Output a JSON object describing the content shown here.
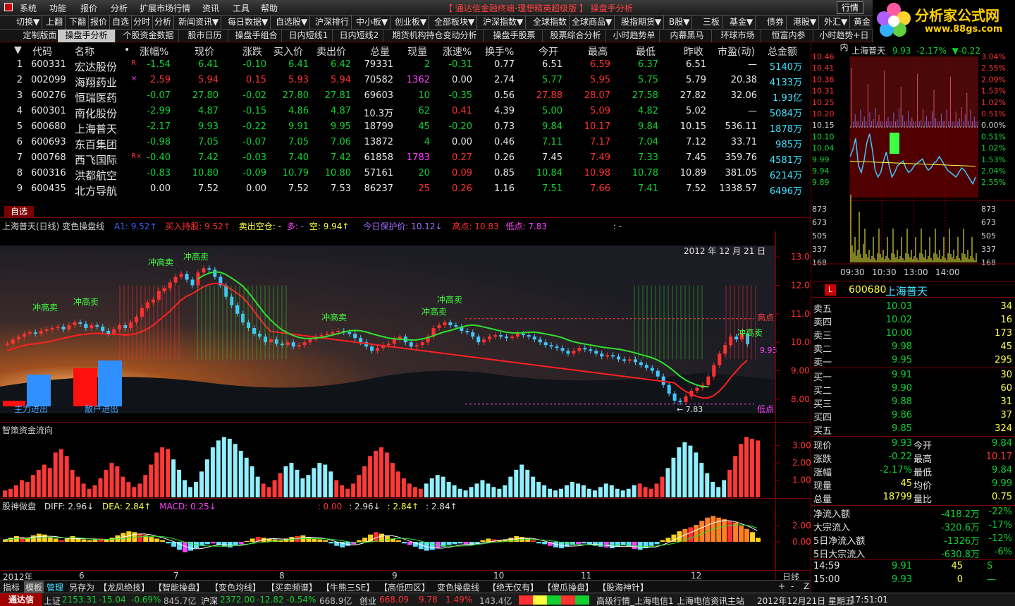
{
  "menu": [
    "系统",
    "功能",
    "报价",
    "分析",
    "扩展市场行情",
    "资讯",
    "工具",
    "帮助"
  ],
  "window_title": "【 通达信金融终端-理想精英超级版 】    操盘手分析",
  "menu_right_button": "行情",
  "logo": {
    "name": "分析家公式网",
    "url": "www.88gs.com"
  },
  "toolbar": [
    "切换▼",
    "上翻",
    "下翻",
    "报价",
    "自选",
    "分时",
    "分析",
    "新闻资讯▼",
    "每日数据▼",
    "自选股▼",
    "沪深排行",
    "中小板▼",
    "创业板▼",
    "全部板块▼",
    "沪深指数▼",
    "全球指数",
    "全球商品▼",
    "股指期货▼",
    "B股▼",
    "三板",
    "基金▼",
    "债券",
    "港股▼",
    "外汇▼",
    "黄金"
  ],
  "tabs": [
    "定制版面",
    "操盘手分析",
    "个股资金数据",
    "股市日历",
    "操盘手组合",
    "日内短线1",
    "日内短线2",
    "期货机构持仓变动分析",
    "操盘手股票",
    "股票综合分析",
    "小时趋势单",
    "内幕黑马",
    "环球市场",
    "恒富内参",
    "小时趋势+日内"
  ],
  "active_tab": 1,
  "table": {
    "headers": [
      "▼",
      "代码",
      "名称",
      "•",
      "涨幅%",
      "现价",
      "涨跌",
      "买入价",
      "卖出价",
      "总量",
      "现量",
      "涨速%",
      "换手%",
      "今开",
      "最高",
      "最低",
      "昨收",
      "市盈(动)",
      "总金额"
    ],
    "rows": [
      {
        "no": "1",
        "code": "600331",
        "name": "宏达股份",
        "flag": "R",
        "pct": "-1.54",
        "price": "6.41",
        "chg": "-0.10",
        "bid": "6.41",
        "ask": "6.42",
        "vol": "79331",
        "cur": "2",
        "speed": "-0.31",
        "turn": "0.77",
        "open": "6.51",
        "high": "6.59",
        "low": "6.37",
        "prev": "6.51",
        "pe": "—",
        "amt": "5140万"
      },
      {
        "no": "2",
        "code": "002099",
        "name": "海翔药业",
        "flag": "×",
        "pct": "2.59",
        "price": "5.94",
        "chg": "0.15",
        "bid": "5.93",
        "ask": "5.94",
        "vol": "70582",
        "cur": "1362",
        "speed": "0.00",
        "turn": "2.74",
        "open": "5.77",
        "high": "5.95",
        "low": "5.75",
        "prev": "5.79",
        "pe": "20.38",
        "amt": "4133万"
      },
      {
        "no": "3",
        "code": "600276",
        "name": "恒瑞医药",
        "flag": "",
        "pct": "-0.07",
        "price": "27.80",
        "chg": "-0.02",
        "bid": "27.80",
        "ask": "27.81",
        "vol": "69603",
        "cur": "10",
        "speed": "-0.35",
        "turn": "0.56",
        "open": "27.88",
        "high": "28.07",
        "low": "27.58",
        "prev": "27.82",
        "pe": "32.06",
        "amt": "1.93亿"
      },
      {
        "no": "4",
        "code": "600301",
        "name": "南化股份",
        "flag": "",
        "pct": "-2.99",
        "price": "4.87",
        "chg": "-0.15",
        "bid": "4.86",
        "ask": "4.87",
        "vol": "10.3万",
        "cur": "62",
        "speed": "0.41",
        "turn": "4.39",
        "open": "5.00",
        "high": "5.09",
        "low": "4.82",
        "prev": "5.02",
        "pe": "—",
        "amt": "5084万"
      },
      {
        "no": "5",
        "code": "600680",
        "name": "上海普天",
        "flag": "",
        "pct": "-2.17",
        "price": "9.93",
        "chg": "-0.22",
        "bid": "9.91",
        "ask": "9.95",
        "vol": "18799",
        "cur": "45",
        "speed": "-0.20",
        "turn": "0.73",
        "open": "9.84",
        "high": "10.17",
        "low": "9.84",
        "prev": "10.15",
        "pe": "536.11",
        "amt": "1878万"
      },
      {
        "no": "6",
        "code": "600693",
        "name": "东百集团",
        "flag": "",
        "pct": "-0.98",
        "price": "7.05",
        "chg": "-0.07",
        "bid": "7.05",
        "ask": "7.06",
        "vol": "13872",
        "cur": "4",
        "speed": "0.00",
        "turn": "0.46",
        "open": "7.11",
        "high": "7.17",
        "low": "7.04",
        "prev": "7.12",
        "pe": "33.71",
        "amt": "985万"
      },
      {
        "no": "7",
        "code": "000768",
        "name": "西飞国际",
        "flag": "R×",
        "pct": "-0.40",
        "price": "7.42",
        "chg": "-0.03",
        "bid": "7.40",
        "ask": "7.42",
        "vol": "61858",
        "cur": "1783",
        "speed": "0.27",
        "turn": "0.26",
        "open": "7.45",
        "high": "7.49",
        "low": "7.33",
        "prev": "7.45",
        "pe": "359.76",
        "amt": "4581万"
      },
      {
        "no": "8",
        "code": "600316",
        "name": "洪都航空",
        "flag": "",
        "pct": "-0.83",
        "price": "10.80",
        "chg": "-0.09",
        "bid": "10.79",
        "ask": "10.80",
        "vol": "57161",
        "cur": "20",
        "speed": "0.09",
        "turn": "0.85",
        "open": "10.84",
        "high": "10.98",
        "low": "10.78",
        "prev": "10.89",
        "pe": "381.05",
        "amt": "6214万"
      },
      {
        "no": "9",
        "code": "600435",
        "name": "北方导航",
        "flag": "",
        "pct": "0.00",
        "price": "7.52",
        "chg": "0.00",
        "bid": "7.52",
        "ask": "7.53",
        "vol": "86237",
        "cur": "25",
        "speed": "0.26",
        "turn": "1.16",
        "open": "7.51",
        "high": "7.66",
        "low": "7.41",
        "prev": "7.52",
        "pe": "1338.57",
        "amt": "6496万"
      }
    ]
  },
  "zixuan_label": "自选",
  "chart_info": {
    "title": "上海普天(日线) 变色操盘线",
    "a1": "A1: 9.52↑",
    "buy_pressure": "买入持股: 9.52↑",
    "sell": "卖出空仓: -",
    "duo": "多: -",
    "kong": "空: 9.94↑",
    "protect": "今日保护价: 10.12↓",
    "high": "高点: 10.83",
    "low": "低点: 7.83",
    "extra": ": -"
  },
  "main_chart": {
    "date": "2012 年 12 月 21 日",
    "y_labels": [
      "13.00",
      "12.00",
      "11.00",
      "10.00",
      "9.00",
      "8.00"
    ],
    "high_label": "高点",
    "low_label": "低点",
    "last_price": "9.93",
    "low_marker": "← 7.83",
    "main_fund_label": "主力进出",
    "retail_fund_label": "散户进出",
    "signal_texts": [
      "冲高卖",
      "冲高卖",
      "冲高卖",
      "冲高卖",
      "冲高卖",
      "冲高卖",
      "冲高卖",
      "冲高卖"
    ]
  },
  "fund_chart": {
    "title": "智策资金流向",
    "y_labels": [
      "3.00",
      "2.00",
      "1.00"
    ]
  },
  "macd_info": {
    "name": "股神做盘",
    "diff": "DIFF: 2.96↓",
    "dea": "DEA: 2.84↑",
    "macd": "MACD: 0.25↓",
    "v1": ": 0.00",
    "v2": ": 2.96↓",
    "v3": ": 2.84↑",
    "v4": ": 2.84↑"
  },
  "macd_chart": {
    "y_labels": [
      "2.00",
      "0.00"
    ]
  },
  "x_axis": [
    "2012年",
    "6",
    "7",
    "8",
    "9",
    "10",
    "11",
    "12"
  ],
  "period_label": "日线",
  "bottom_tabs": [
    "指标",
    "模板",
    "管理",
    "另存为",
    "【龙凤绝技】",
    "【智能操盘】",
    "【变色均线】",
    "【买卖频谱】",
    "【牛熊三SE】",
    "【高低四区】",
    "变色操盘线",
    "【绝无仅有】",
    "【傻瓜操盘】",
    "【股海神针】"
  ],
  "bottom_tools": [
    "+",
    "-",
    "Z"
  ],
  "mini": {
    "title": "上海普天",
    "price": "9.93",
    "pct": "-2.17%",
    "chg": "▼-0.22",
    "left_labels": [
      "10.46",
      "10.41",
      "10.36",
      "10.31",
      "10.25",
      "10.20",
      "10.15",
      "10.10",
      "10.04",
      "9.99",
      "9.94",
      "9.89",
      "873",
      "673",
      "505",
      "337",
      "168"
    ],
    "right_labels": [
      "3.04%",
      "2.55%",
      "2.09%",
      "1.53%",
      "1.02%",
      "0.51%",
      "0.00%",
      "0.51%",
      "1.02%",
      "1.53%",
      "2.04%",
      "2.55%",
      "873",
      "673",
      "505",
      "337",
      "168"
    ],
    "times": [
      "09:30",
      "10:30",
      "13:00",
      "14:00"
    ]
  },
  "stock": {
    "code": "600680",
    "name": "上海普天",
    "badge": "L"
  },
  "orderbook": {
    "asks": [
      {
        "label": "卖五",
        "price": "10.03",
        "vol": "34"
      },
      {
        "label": "卖四",
        "price": "10.02",
        "vol": "16"
      },
      {
        "label": "卖三",
        "price": "10.00",
        "vol": "173"
      },
      {
        "label": "卖二",
        "price": "9.98",
        "vol": "45"
      },
      {
        "label": "卖一",
        "price": "9.95",
        "vol": "295"
      }
    ],
    "bids": [
      {
        "label": "买一",
        "price": "9.91",
        "vol": "30"
      },
      {
        "label": "买二",
        "price": "9.90",
        "vol": "60"
      },
      {
        "label": "买三",
        "price": "9.88",
        "vol": "31"
      },
      {
        "label": "买四",
        "price": "9.86",
        "vol": "37"
      },
      {
        "label": "买五",
        "price": "9.85",
        "vol": "324"
      }
    ]
  },
  "stats": [
    {
      "l1": "现价",
      "v1": "9.93",
      "l2": "今开",
      "v2": "9.84"
    },
    {
      "l1": "涨跌",
      "v1": "-0.22",
      "l2": "最高",
      "v2": "10.17"
    },
    {
      "l1": "涨幅",
      "v1": "-2.17%",
      "l2": "最低",
      "v2": "9.84"
    },
    {
      "l1": "现量",
      "v1": "45",
      "l2": "均价",
      "v2": "9.99"
    },
    {
      "l1": "总量",
      "v1": "18799",
      "l2": "量比",
      "v2": "0.75"
    }
  ],
  "flows": [
    {
      "label": "净流入额",
      "value": "-418.2万",
      "pct": "-22%"
    },
    {
      "label": "大宗流入",
      "value": "-320.6万",
      "pct": "-17%"
    },
    {
      "label": "5日净流入额",
      "value": "-1326万",
      "pct": "-12%"
    },
    {
      "label": "5日大宗流入",
      "value": "-630.8万",
      "pct": "-6%"
    }
  ],
  "ticks": [
    {
      "time": "14:59",
      "price": "9.91",
      "vol": "45",
      "side": "S"
    },
    {
      "time": "15:00",
      "price": "9.93",
      "vol": "0",
      "side": "—"
    }
  ],
  "status": {
    "brand": "通达信",
    "sh_label": "上证",
    "sh_val": "2153.31",
    "sh_chg": "-15.04",
    "sh_pct": "-0.69%",
    "sh_amt": "845.7亿",
    "sz_label": "沪深",
    "sz_val": "2372.00",
    "sz_chg": "-12.82",
    "sz_pct": "-0.54%",
    "sz_amt": "668.9亿",
    "cy_label": "创业",
    "cy_val": "668.09",
    "cy_chg": "9.78",
    "cy_pct": "1.49%",
    "cy_amt": "143.4亿",
    "server": "高级行情_上海电信1",
    "info": "上海电信资讯主站",
    "datetime": "2012年12月21日 星期五",
    "clock": "17:51:01"
  }
}
